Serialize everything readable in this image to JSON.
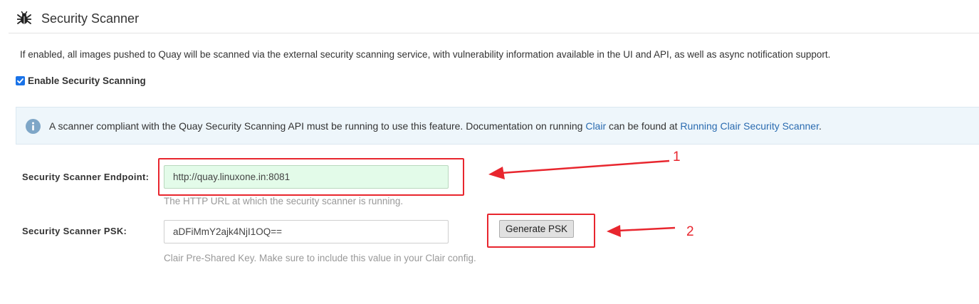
{
  "header": {
    "title": "Security Scanner",
    "icon": "bug-icon"
  },
  "description": "If enabled, all images pushed to Quay will be scanned via the external security scanning service, with vulnerability information available in the UI and API, as well as async notification support.",
  "enable_checkbox": {
    "label": "Enable Security Scanning",
    "checked": true
  },
  "info": {
    "icon": "info-circle-icon",
    "text_before": "A scanner compliant with the Quay Security Scanning API must be running to use this feature. Documentation on running ",
    "link1": "Clair",
    "text_middle": " can be found at ",
    "link2": "Running Clair Security Scanner",
    "text_after": "."
  },
  "endpoint": {
    "label": "Security Scanner Endpoint:",
    "value": "http://quay.linuxone.in:8081",
    "help": "The HTTP URL at which the security scanner is running."
  },
  "psk": {
    "label": "Security Scanner PSK:",
    "value": "aDFiMmY2ajk4NjI1OQ==",
    "help": "Clair Pre-Shared Key. Make sure to include this value in your Clair config.",
    "button_label": "Generate PSK"
  },
  "annotations": {
    "marker1": "1",
    "marker2": "2",
    "color": "#e8262e"
  },
  "colors": {
    "link": "#2a6bb0",
    "info_bg": "#eef6fb",
    "valid_input_bg": "#e3fbe9",
    "checkbox": "#1a73e8"
  }
}
